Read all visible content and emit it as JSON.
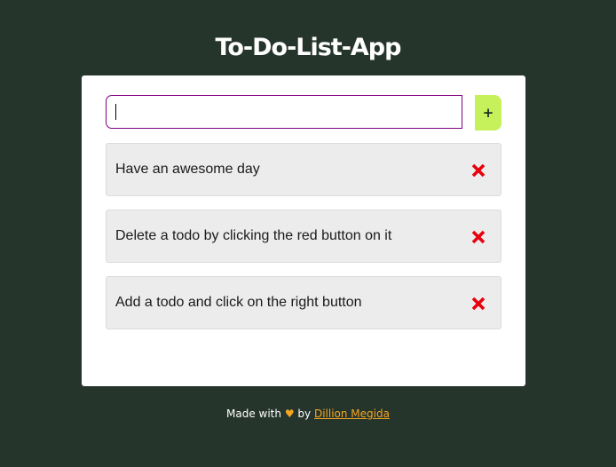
{
  "app": {
    "title": "To-Do-List-App"
  },
  "form": {
    "input_value": "",
    "add_button_label": "+"
  },
  "todos": [
    {
      "text": "Have an awesome day"
    },
    {
      "text": "Delete a todo by clicking the red button on it"
    },
    {
      "text": "Add a todo and click on the right button"
    }
  ],
  "footer": {
    "made_with": "Made with",
    "heart": "♥",
    "by": "by",
    "author": "Dillion Megida"
  },
  "icons": {
    "delete": "close-x-icon",
    "add": "plus-icon"
  },
  "colors": {
    "background": "#25352c",
    "add_button": "#c6f15a",
    "input_border": "#800080",
    "delete_icon": "#e8000d",
    "accent": "#f5a623"
  }
}
